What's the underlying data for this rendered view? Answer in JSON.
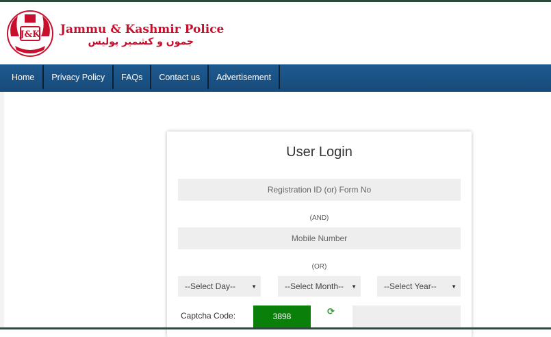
{
  "header": {
    "brand_en": "Jammu & Kashmir Police",
    "brand_ur": "جموں و کشمیر پولیس",
    "logo_icon": "jk-police-emblem-icon"
  },
  "nav": {
    "items": [
      "Home",
      "Privacy Policy",
      "FAQs",
      "Contact us",
      "Advertisement"
    ]
  },
  "login": {
    "title": "User Login",
    "registration_placeholder": "Registration ID (or) Form No",
    "and_label": "(AND)",
    "mobile_placeholder": "Mobile Number",
    "or_label": "(OR)",
    "day_select": "--Select Day--",
    "month_select": "--Select Month--",
    "year_select": "--Select Year--",
    "captcha_label": "Captcha Code:",
    "captcha_value": "3898",
    "refresh_icon": "refresh-icon",
    "captcha_input_placeholder": ""
  },
  "colors": {
    "brand_red": "#c8102e",
    "nav_blue": "#1f5a90",
    "captcha_green": "#0a7f0a"
  }
}
